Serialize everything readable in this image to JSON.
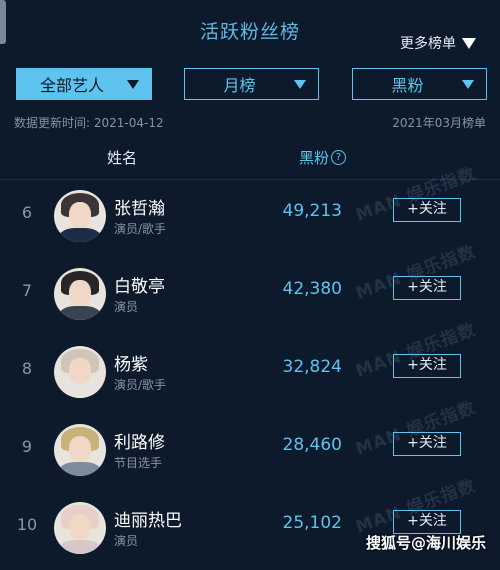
{
  "header": {
    "title": "活跃粉丝榜",
    "more_label": "更多榜单"
  },
  "filters": {
    "artist": "全部艺人",
    "period": "月榜",
    "fan_type": "黑粉"
  },
  "meta": {
    "update_time": "数据更新时间: 2021-04-12",
    "period_label": "2021年03月榜单"
  },
  "table": {
    "col_name": "姓名",
    "col_fans": "黑粉",
    "help_icon_char": "?"
  },
  "rows": [
    {
      "rank": "6",
      "name": "张哲瀚",
      "role": "演员/歌手",
      "fans": "49,213",
      "follow": "+关注",
      "hair": "#3a3536",
      "body": "#1d2c44"
    },
    {
      "rank": "7",
      "name": "白敬亭",
      "role": "演员",
      "fans": "42,380",
      "follow": "+关注",
      "hair": "#2a2627",
      "body": "#3a4350"
    },
    {
      "rank": "8",
      "name": "杨紫",
      "role": "演员/歌手",
      "fans": "32,824",
      "follow": "+关注",
      "hair": "#cfc5b9",
      "body": "#e7e3e0"
    },
    {
      "rank": "9",
      "name": "利路修",
      "role": "节目选手",
      "fans": "28,460",
      "follow": "+关注",
      "hair": "#c9b27a",
      "body": "#7d8c9c"
    },
    {
      "rank": "10",
      "name": "迪丽热巴",
      "role": "演员",
      "fans": "25,102",
      "follow": "+关注",
      "hair": "#e8cfc9",
      "body": "#d6c8c8"
    }
  ],
  "watermark": {
    "row_text": "MAN 娱乐指数",
    "footer_text": "搜狐号@海川娱乐"
  }
}
